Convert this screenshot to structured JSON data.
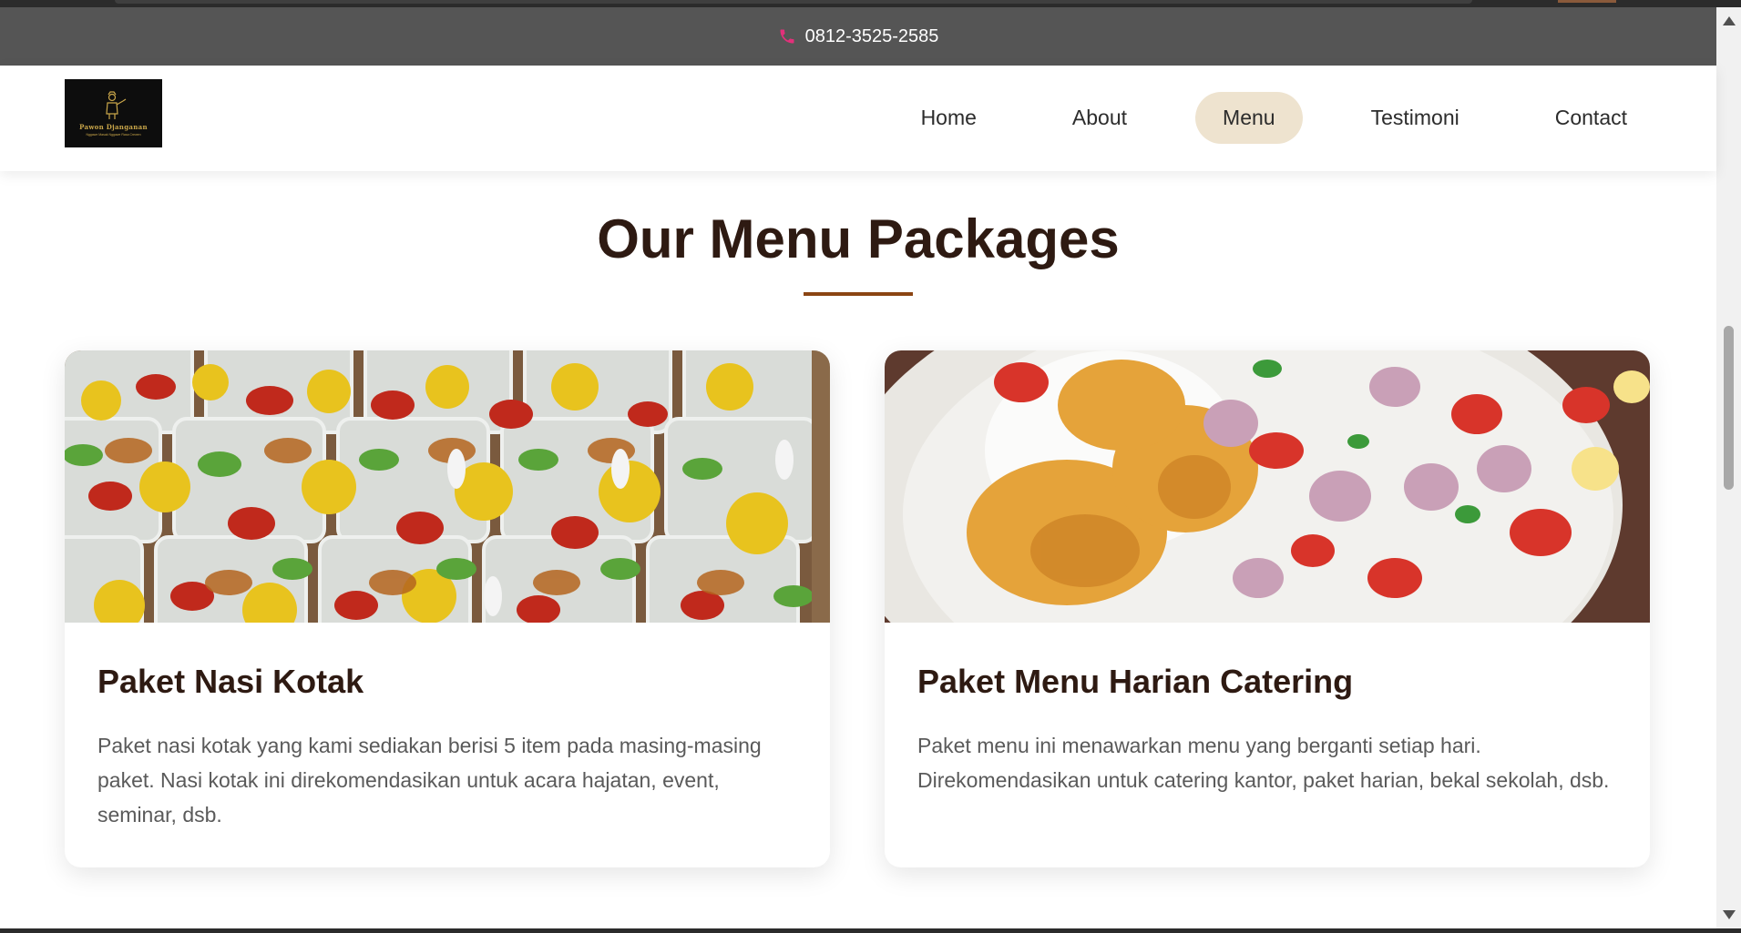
{
  "topbar": {
    "phone_icon": "phone-icon",
    "phone": "0812-3525-2585",
    "accent_color": "#e2307a"
  },
  "header": {
    "logo": {
      "name": "Pawon Djanganan",
      "tagline": "Nggawe Masak Nggawe Rasa Crewen"
    },
    "nav": [
      {
        "label": "Home",
        "active": false
      },
      {
        "label": "About",
        "active": false
      },
      {
        "label": "Menu",
        "active": true
      },
      {
        "label": "Testimoni",
        "active": false
      },
      {
        "label": "Contact",
        "active": false
      }
    ]
  },
  "section": {
    "title": "Our Menu Packages",
    "underline_color": "#8b4513"
  },
  "cards": [
    {
      "title": "Paket Nasi Kotak",
      "description": "Paket nasi kotak yang kami sediakan berisi 5 item pada masing-masing paket. Nasi kotak ini direkomendasikan untuk acara hajatan, event, seminar, dsb.",
      "image": "nasi-kotak-photo"
    },
    {
      "title": "Paket Menu Harian Catering",
      "description": "Paket menu ini menawarkan menu yang berganti setiap hari. Direkomendasikan untuk catering kantor, paket harian, bekal sekolah, dsb.",
      "image": "menu-harian-photo"
    }
  ],
  "colors": {
    "topbar_bg": "#555555",
    "active_nav_bg": "#eee3cf",
    "heading": "#2e1a12",
    "body_text": "#5a5a5a"
  }
}
